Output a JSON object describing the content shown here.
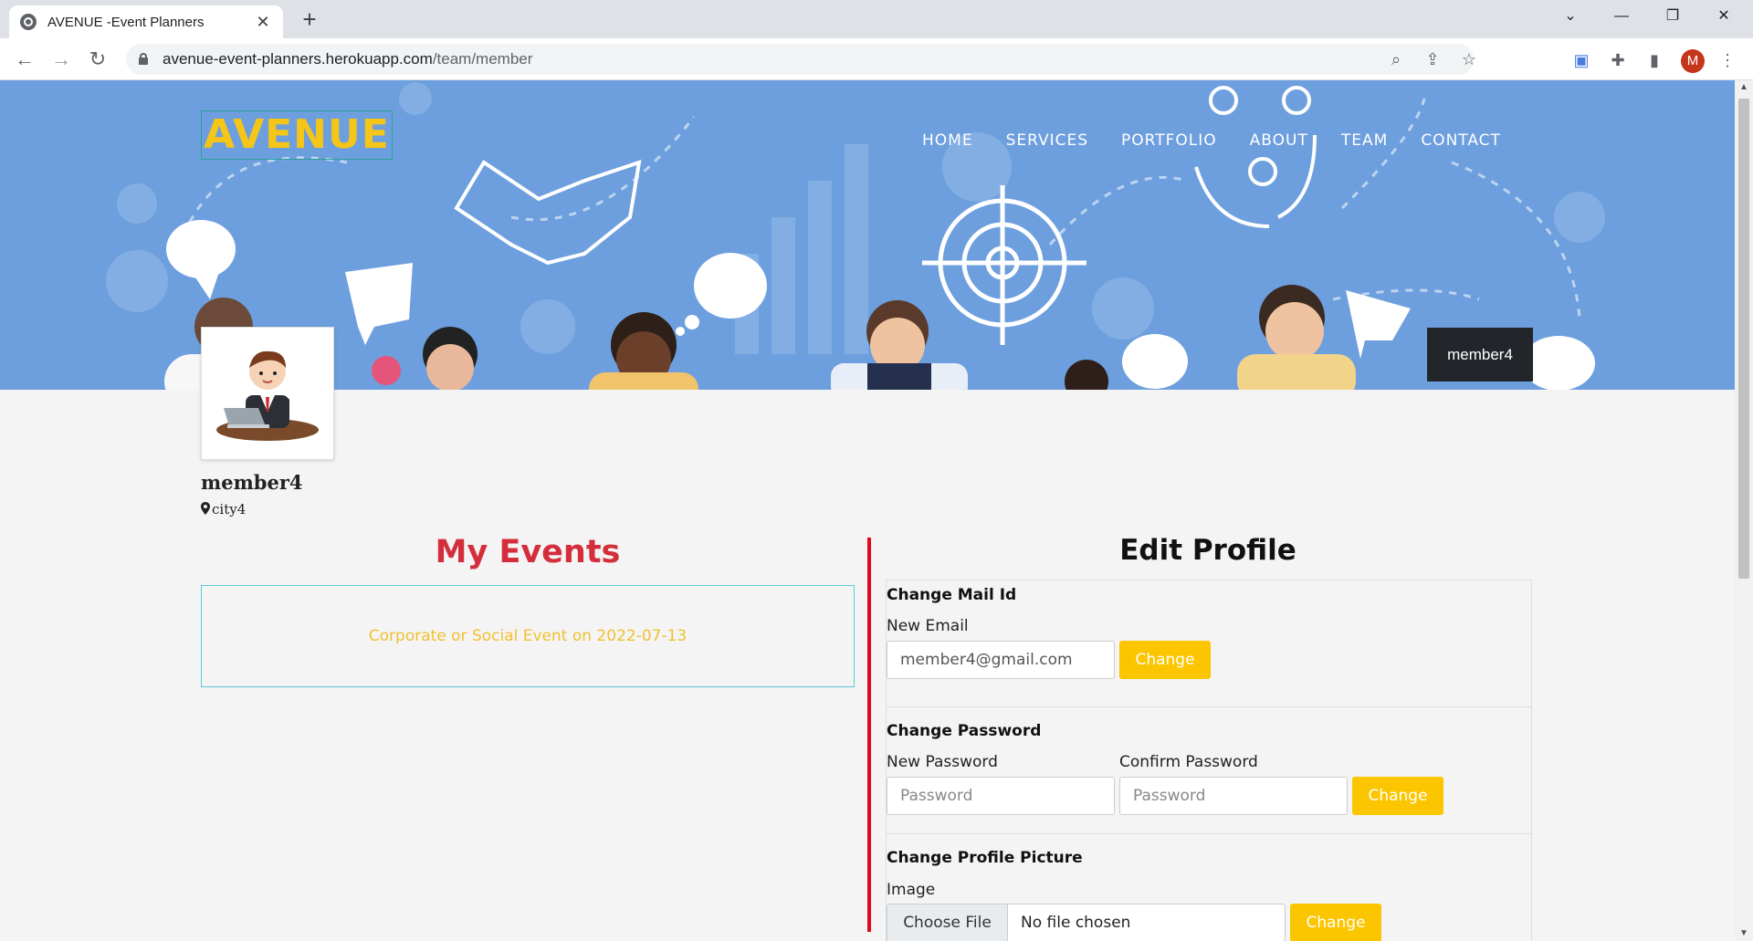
{
  "browser": {
    "tab_title": "AVENUE -Event Planners",
    "url_host": "avenue-event-planners.herokuapp.com",
    "url_path": "/team/member",
    "profile_initial": "M"
  },
  "header": {
    "brand": "AVENUE",
    "nav": [
      "HOME",
      "SERVICES",
      "PORTFOLIO",
      "ABOUT",
      "TEAM",
      "CONTACT"
    ],
    "user_chip": "member4"
  },
  "profile": {
    "name": "member4",
    "city": "city4"
  },
  "events": {
    "title": "My Events",
    "items": [
      "Corporate or Social Event on 2022-07-13"
    ]
  },
  "edit_profile": {
    "title": "Edit Profile",
    "mail": {
      "heading": "Change Mail Id",
      "label": "New Email",
      "value": "member4@gmail.com",
      "button": "Change"
    },
    "password": {
      "heading": "Change Password",
      "new_label": "New Password",
      "new_placeholder": "Password",
      "confirm_label": "Confirm Password",
      "confirm_placeholder": "Password",
      "button": "Change"
    },
    "picture": {
      "heading": "Change Profile Picture",
      "label": "Image",
      "choose_label": "Choose File",
      "status": "No file chosen",
      "button": "Change"
    }
  },
  "colors": {
    "hero_bg": "#6d9fde",
    "brand_yellow": "#f5c518",
    "events_red": "#d42e3c",
    "divider_red": "#e3081c",
    "button_yellow": "#fbc500",
    "event_text": "#f2c12e",
    "event_border": "#5cc8d8"
  }
}
